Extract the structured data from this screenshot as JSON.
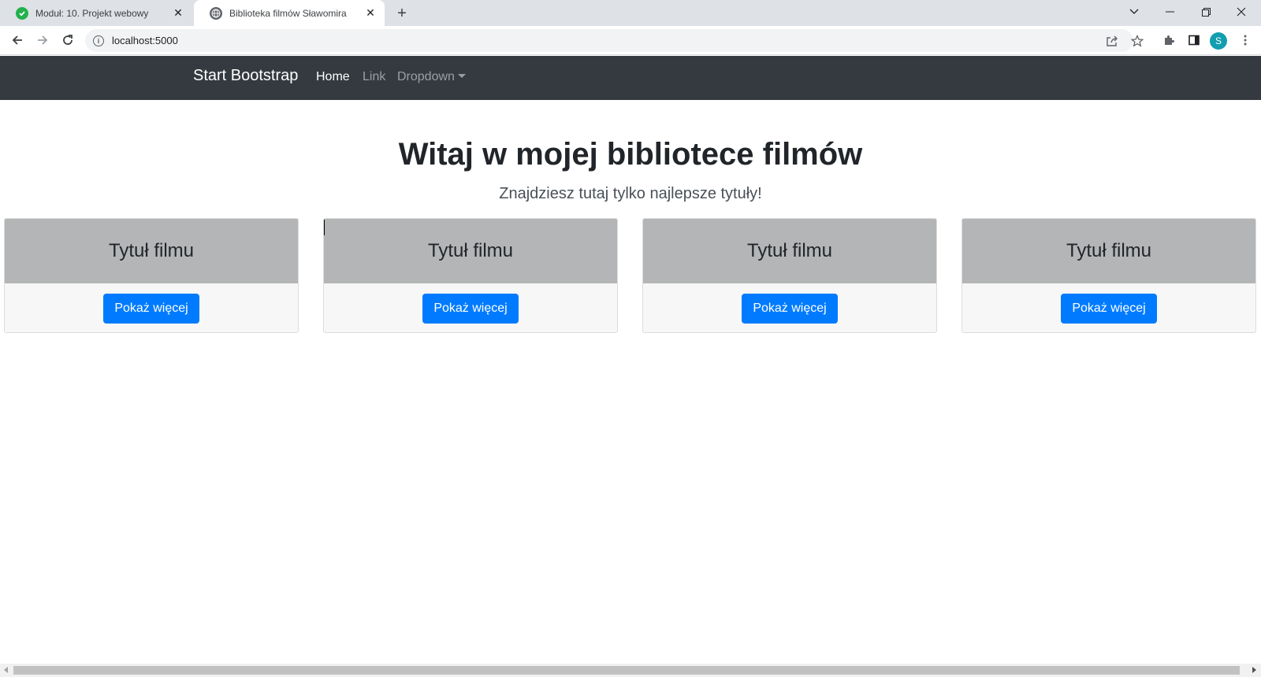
{
  "browser": {
    "tabs": [
      {
        "title": "Moduł: 10. Projekt webowy",
        "icon": "check-circle-icon",
        "active": false
      },
      {
        "title": "Biblioteka filmów Sławomira",
        "icon": "globe-icon",
        "active": true
      }
    ],
    "new_tab_glyph": "+",
    "url": "localhost:5000",
    "profile_initial": "S"
  },
  "navbar": {
    "brand": "Start Bootstrap",
    "links": [
      {
        "label": "Home",
        "active": true
      },
      {
        "label": "Link",
        "active": false
      },
      {
        "label": "Dropdown",
        "active": false
      }
    ]
  },
  "hero": {
    "title": "Witaj w mojej bibliotece filmów",
    "subtitle": "Znajdziesz tutaj tylko najlepsze tytuły!"
  },
  "cards": [
    {
      "title": "Tytuł filmu",
      "button": "Pokaż więcej"
    },
    {
      "title": "Tytuł filmu",
      "button": "Pokaż więcej"
    },
    {
      "title": "Tytuł filmu",
      "button": "Pokaż więcej"
    },
    {
      "title": "Tytuł filmu",
      "button": "Pokaż więcej"
    }
  ],
  "colors": {
    "navbar_bg": "#343a40",
    "card_header_bg": "#b4b5b7",
    "primary": "#007bff"
  }
}
